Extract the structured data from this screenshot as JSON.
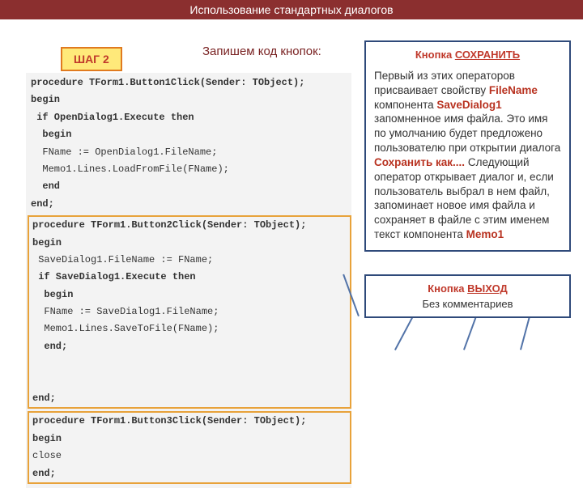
{
  "header": "Использование стандартных диалогов",
  "step_label": "ШАГ 2",
  "prompt": "Запишем код кнопок:",
  "code": {
    "p1_l1": "procedure TForm1.Button1Click(Sender: TObject);",
    "p1_l2": "begin",
    "p1_l3": " if OpenDialog1.Execute then",
    "p1_l4": "  begin",
    "p1_l5": "  FName := OpenDialog1.FileName;",
    "p1_l6": "  Memo1.Lines.LoadFromFile(FName);",
    "p1_l7": "  end",
    "p1_l8": "end;",
    "p2_l1": "procedure TForm1.Button2Click(Sender: TObject);",
    "p2_l2": "begin",
    "p2_l3": " SaveDialog1.FileName := FName;",
    "p2_l4": " if SaveDialog1.Execute then",
    "p2_l5": "  begin",
    "p2_l6": "  FName := SaveDialog1.FileName;",
    "p2_l7": "  Memo1.Lines.SaveToFile(FName);",
    "p2_l8": "  end;",
    "p2_l10": "end;",
    "p3_l1": "procedure TForm1.Button3Click(Sender: TObject);",
    "p3_l2": "begin",
    "p3_l3": "close",
    "p3_l4": "end;"
  },
  "save": {
    "title_prefix": "Кнопка ",
    "title_action": " СОХРАНИТЬ",
    "para_pre": " Первый из этих операторов присваивает свойству ",
    "token_filename": "FileName",
    "para_mid1": " компонента ",
    "token_savedialog": "SaveDialog1",
    "para_mid2": " запомненное имя файла. Это имя по умолчанию будет предложено пользователю при открытии диалога ",
    "token_saveas": "Сохранить как....",
    "para_mid3": " Следующий оператор открывает диалог и, если пользователь выбрал в нем файл, запоминает новое имя файла и сохраняет в файле с этим именем текст компонента ",
    "token_memo": "Memo1"
  },
  "exit": {
    "title_prefix": "Кнопка ",
    "title_action": " ВЫХОД",
    "subtitle": "Без комментариев"
  }
}
